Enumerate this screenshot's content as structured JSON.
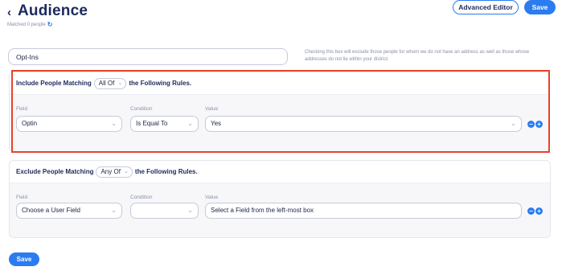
{
  "header": {
    "back_icon": "chevron-left-icon",
    "title": "Audience",
    "matched_text": "Matched 0 people",
    "refresh_icon": "refresh-icon",
    "advanced_editor_label": "Advanced Editor",
    "save_label": "Save"
  },
  "audience_name": {
    "value": "Opt-Ins",
    "note": "Checking this box will exclude those people for whom we do not have an address as well as those whose addresses do not lie within your district."
  },
  "include": {
    "prefix": "Include People Matching",
    "match_mode": "All Of",
    "suffix": "the Following Rules.",
    "labels": {
      "field": "Field",
      "condition": "Condition",
      "value": "Value"
    },
    "rule": {
      "field": "Optin",
      "condition": "Is Equal To",
      "value": "Yes"
    }
  },
  "exclude": {
    "prefix": "Exclude People Matching",
    "match_mode": "Any Of",
    "suffix": "the Following Rules.",
    "labels": {
      "field": "Field",
      "condition": "Condition",
      "value": "Value"
    },
    "rule": {
      "field": "Choose a User Field",
      "condition": "",
      "value": "Select a Field from the left-most box"
    }
  },
  "icons": {
    "remove": "minus-circle-icon",
    "add": "plus-circle-icon",
    "dropdown": "chevron-down-icon"
  },
  "footer": {
    "save_label": "Save"
  },
  "colors": {
    "accent": "#2b7cf0",
    "highlight": "#e8432b",
    "heading": "#1c2a5c"
  }
}
